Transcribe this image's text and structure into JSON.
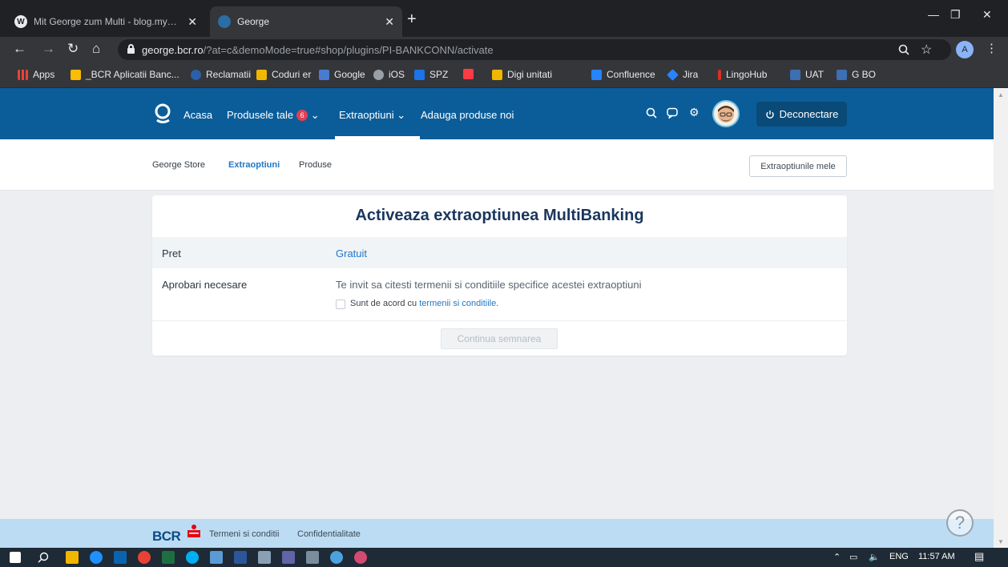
{
  "browser": {
    "tabs": [
      {
        "title": "Mit George zum Multi - blog.my…",
        "favicon": "wordpress-icon",
        "close": "✕"
      },
      {
        "title": "George",
        "favicon": "george-icon",
        "close": "✕"
      }
    ],
    "new_tab": "+",
    "url_host": "george.bcr.ro",
    "url_path": "/?at=c&demoMode=true#shop/plugins/PI-BANKCONN/activate",
    "profile_initial": "A",
    "bookmarks": [
      {
        "label": "Apps",
        "color": "#ea4335"
      },
      {
        "label": "_BCR Aplicatii Banc...",
        "color": "#fbbc04"
      },
      {
        "label": "Reclamatii",
        "color": "#2b5fa8"
      },
      {
        "label": "Coduri er",
        "color": "#f1b600"
      },
      {
        "label": "Google",
        "color": "#4a7bd0"
      },
      {
        "label": "iOS",
        "color": "#9aa0a6"
      },
      {
        "label": "SPZ",
        "color": "#1a73e8"
      },
      {
        "label": "Digi unitati",
        "color": "#f1b600"
      },
      {
        "label": "Confluence",
        "color": "#2684ff"
      },
      {
        "label": "Jira",
        "color": "#2684ff"
      },
      {
        "label": "LingoHub",
        "color": "#d93025"
      },
      {
        "label": "UAT",
        "color": "#3c6fb4"
      },
      {
        "label": "G BO",
        "color": "#3c6fb4"
      }
    ]
  },
  "header": {
    "nav": [
      {
        "label": "Acasa"
      },
      {
        "label": "Produsele tale",
        "badge": "6"
      },
      {
        "label": "Extraoptiuni"
      },
      {
        "label": "Adauga produse noi"
      }
    ],
    "logout_label": "Deconectare",
    "brand_color": "#0b5d99"
  },
  "subnav": {
    "items": [
      "George Store",
      "Extraoptiuni",
      "Produse"
    ],
    "active": "Extraoptiuni",
    "my_options_button": "Extraoptiunile mele"
  },
  "card": {
    "title": "Activeaza extraoptiunea MultiBanking",
    "price_label": "Pret",
    "price_value": "Gratuit",
    "approvals_label": "Aprobari necesare",
    "approvals_text": "Te invit sa citesti termenii si conditiile specifice acestei extraoptiuni",
    "checkbox_prefix": "Sunt de acord cu ",
    "checkbox_link": "termenii si conditiile",
    "checkbox_suffix": ".",
    "checkbox_checked": false,
    "continue_button": "Continua semnarea",
    "continue_enabled": false
  },
  "footer": {
    "brand": "BCR",
    "links": [
      "Termeni si conditii",
      "Confidentialitate"
    ],
    "help_symbol": "?"
  },
  "taskbar": {
    "language": "ENG",
    "time": "11:57 AM"
  }
}
